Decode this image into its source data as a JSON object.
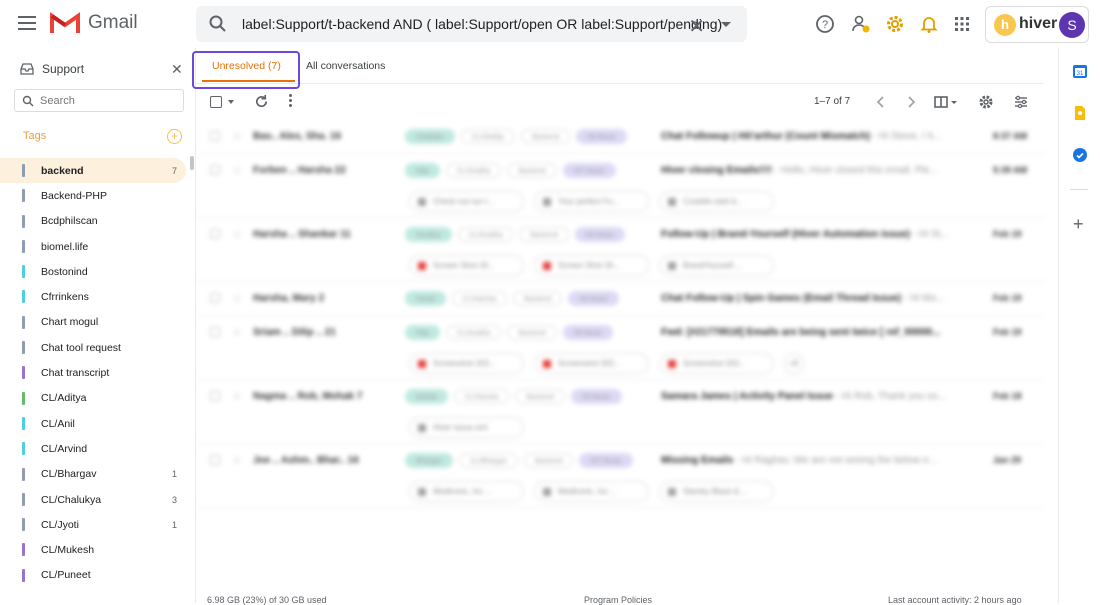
{
  "app": {
    "name": "Gmail"
  },
  "search": {
    "query": "label:Support/t-backend  AND ( label:Support/open OR  label:Support/pending)"
  },
  "hiver": {
    "name": "hiver",
    "avatar_letter": "S"
  },
  "sidebar": {
    "title": "Support",
    "search_placeholder": "Search",
    "tags_label": "Tags",
    "tags": [
      {
        "name": "backend",
        "count": "7",
        "color": "#8e9bb3",
        "active": true
      },
      {
        "name": "Backend-PHP",
        "count": "",
        "color": "#8e9bb3"
      },
      {
        "name": "Bcdphilscan",
        "count": "",
        "color": "#8e9bb3"
      },
      {
        "name": "biomel.life",
        "count": "",
        "color": "#8e9bb3"
      },
      {
        "name": "Bostonind",
        "count": "",
        "color": "#4dd0e1"
      },
      {
        "name": "Cfrrinkens",
        "count": "",
        "color": "#4dd0e1"
      },
      {
        "name": "Chart mogul",
        "count": "",
        "color": "#8e9bb3"
      },
      {
        "name": "Chat tool request",
        "count": "",
        "color": "#8e9bb3"
      },
      {
        "name": "Chat transcript",
        "count": "",
        "color": "#9575cd"
      },
      {
        "name": "CL/Aditya",
        "count": "",
        "color": "#66bb6a"
      },
      {
        "name": "CL/Anil",
        "count": "",
        "color": "#4dd0e1"
      },
      {
        "name": "CL/Arvind",
        "count": "",
        "color": "#4dd0e1"
      },
      {
        "name": "CL/Bhargav",
        "count": "1",
        "color": "#8e9bb3"
      },
      {
        "name": "CL/Chalukya",
        "count": "3",
        "color": "#8e9bb3"
      },
      {
        "name": "CL/Jyoti",
        "count": "1",
        "color": "#8e9bb3"
      },
      {
        "name": "CL/Mukesh",
        "count": "",
        "color": "#9575cd"
      },
      {
        "name": "CL/Puneet",
        "count": "",
        "color": "#9575cd"
      }
    ]
  },
  "tabs": {
    "unresolved": "Unresolved (7)",
    "all": "All conversations"
  },
  "toolbar": {
    "pager": "1–7 of 7"
  },
  "emails": [
    {
      "sender": "Bas.. Alex, Sha.  16",
      "labels": [
        "Chatlabs",
        "CL/Shelby",
        "Backend",
        "Hit Music"
      ],
      "subject": "Chat Followup | Hit'arthur (Count Mismatch)",
      "snippet": " - Hi Steve, I h...",
      "date": "8:37 AM",
      "attachments": [],
      "height": 34
    },
    {
      "sender": "Forben .. Harsha  22",
      "labels": [
        "Http",
        "CL/Aradha",
        "Backend",
        "HIT Music"
      ],
      "subject": "Hiver closing Emails!!!!",
      "snippet": " - Hello, Hiver closed this email. Ple...",
      "date": "5:39 AM",
      "attachments": [
        {
          "name": "Check out our t...",
          "red": false
        },
        {
          "name": "Your perfect Fu...",
          "red": false
        },
        {
          "name": "Costello start b...",
          "red": false
        }
      ],
      "height": 64
    },
    {
      "sender": "Harsha .. Shankar  11",
      "labels": [
        "Smallus",
        "CL/Aradha",
        "Backend",
        "Hit Music"
      ],
      "subject": "Follow-Up | Brand-Yourself (Hiver Automation issue)",
      "snippet": " - Hi St...",
      "date": "Feb 19",
      "attachments": [
        {
          "name": "Screen Shot 20...",
          "red": true
        },
        {
          "name": "Screen Shot 20...",
          "red": true
        },
        {
          "name": "BrandYourself ...",
          "red": false
        }
      ],
      "height": 64
    },
    {
      "sender": "Harsha, Mary  2",
      "labels": [
        "Hiwall",
        "CL/Harsha",
        "Backend",
        "Hit Music"
      ],
      "subject": "Chat Follow-Up | Spin Games (Email Thread Issue)",
      "snippet": " - Hi Mo...",
      "date": "Feb 19",
      "attachments": [],
      "height": 34
    },
    {
      "sender": "Sriam .. Dilip ..  21",
      "labels": [
        "Http",
        "CL/Aradha",
        "Backend",
        "Hit Music"
      ],
      "subject": "Fwd: [#21779518] Emails are being sent twice [ ref_00000...",
      "snippet": "",
      "date": "Feb 19",
      "attachments": [
        {
          "name": "Screenshot 202...",
          "red": true
        },
        {
          "name": "Screenshot 202...",
          "red": true
        },
        {
          "name": "Screenshot 202...",
          "red": true
        },
        {
          "name": "+8",
          "more": true
        }
      ],
      "height": 64
    },
    {
      "sender": "Nagma .. Rob, Mohak  7",
      "labels": [
        "Mohak",
        "CL/Harsha",
        "Backend",
        "Hit Music"
      ],
      "subject": "Samara James | Activity Panel Issue",
      "snippet": " - Hi Rob, Thank you so...",
      "date": "Feb 18",
      "attachments": [
        {
          "name": "Hiver issue.xml",
          "red": false
        }
      ],
      "height": 64
    },
    {
      "sender": "Joe .. Ashm.. Bhar..  16",
      "labels": [
        "Bhargav",
        "CL/Bhargav",
        "Backend",
        "HIT Music"
      ],
      "subject": "Missing Emails",
      "snippet": " - Hi Raghav, We are not seeing the below e...",
      "date": "Jan 29",
      "attachments": [
        {
          "name": "Medtronic, Inc ...",
          "red": false
        },
        {
          "name": "Medtronic, Inc ...",
          "red": false
        },
        {
          "name": "Stanley Black & ...",
          "red": false
        }
      ],
      "height": 64
    }
  ],
  "footer": {
    "storage": "6.98 GB (23%) of 30 GB used",
    "policies": "Program Policies",
    "activity": "Last account activity: 2 hours ago"
  },
  "colors": {
    "accent": "#e8710a",
    "highlight_box": "#6c48e0",
    "active_tag_bg": "#fdf0dd",
    "tags_label": "#e8a04c"
  }
}
